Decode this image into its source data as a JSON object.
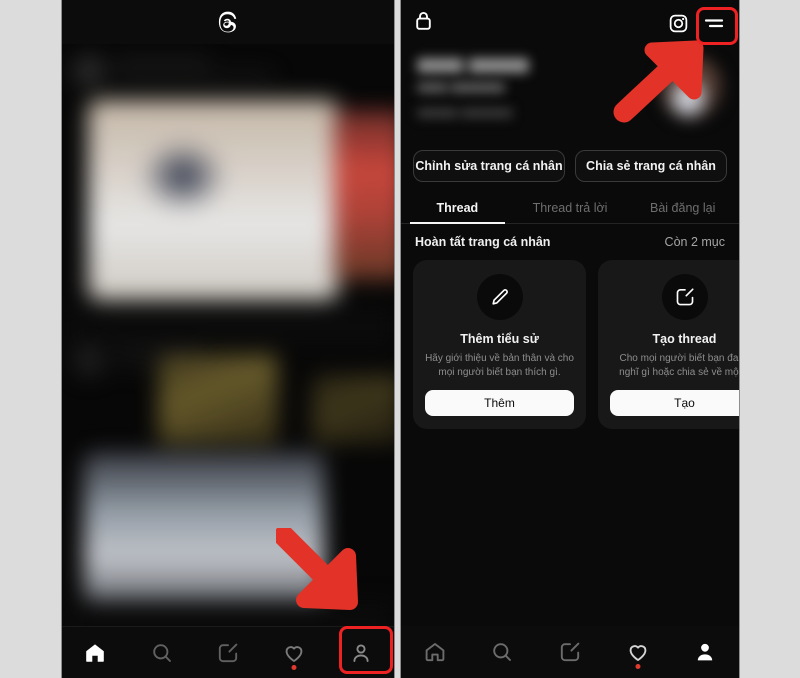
{
  "app": {
    "name": "Threads",
    "logo_icon": "threads-logo-icon"
  },
  "left_panel": {
    "topbar": {
      "logo_icon": "threads-logo-icon"
    },
    "feed_state": "blurred-feed-content",
    "bottom_nav": {
      "items": [
        {
          "icon": "home-icon",
          "label": "Trang chủ",
          "active": true,
          "badge": false
        },
        {
          "icon": "search-icon",
          "label": "Tìm kiếm",
          "active": false,
          "badge": false
        },
        {
          "icon": "compose-icon",
          "label": "Tạo",
          "active": false,
          "badge": false
        },
        {
          "icon": "heart-icon",
          "label": "Hoạt động",
          "active": false,
          "badge": true
        },
        {
          "icon": "profile-icon",
          "label": "Trang cá nhân",
          "active": false,
          "badge": false
        }
      ]
    },
    "annotation": {
      "arrow": "red-arrow-down-right",
      "highlight_target": "profile-nav-icon"
    }
  },
  "right_panel": {
    "topbar": {
      "lock_icon": "lock-icon",
      "instagram_icon": "instagram-icon",
      "menu_icon": "hamburger-menu-icon"
    },
    "profile": {
      "name_state": "blurred",
      "username_state": "blurred",
      "bio_state": "blurred",
      "avatar_state": "blurred"
    },
    "actions": [
      {
        "label": "Chỉnh sửa trang cá nhân",
        "name": "edit-profile-button"
      },
      {
        "label": "Chia sẻ trang cá nhân",
        "name": "share-profile-button"
      }
    ],
    "tabs": [
      {
        "label": "Thread",
        "active": true
      },
      {
        "label": "Thread trả lời",
        "active": false
      },
      {
        "label": "Bài đăng lại",
        "active": false
      }
    ],
    "complete_profile": {
      "title": "Hoàn tất trang cá nhân",
      "count": "Còn 2 mục"
    },
    "cards": [
      {
        "icon": "pencil-icon",
        "title": "Thêm tiểu sử",
        "desc": "Hãy giới thiệu về bản thân và cho mọi người biết bạn thích gì.",
        "button": "Thêm"
      },
      {
        "icon": "compose-icon",
        "title": "Tạo thread",
        "desc": "Cho mọi người biết bạn đang nghĩ gì hoặc chia sẻ về một h",
        "button": "Tạo"
      }
    ],
    "bottom_nav": {
      "items": [
        {
          "icon": "home-icon",
          "label": "Trang chủ",
          "active": false,
          "badge": false
        },
        {
          "icon": "search-icon",
          "label": "Tìm kiếm",
          "active": false,
          "badge": false
        },
        {
          "icon": "compose-icon",
          "label": "Tạo",
          "active": false,
          "badge": false
        },
        {
          "icon": "heart-icon",
          "label": "Hoạt động",
          "active": false,
          "badge": true
        },
        {
          "icon": "profile-icon",
          "label": "Trang cá nhân",
          "active": true,
          "badge": false
        }
      ]
    },
    "annotation": {
      "arrow": "red-arrow-up-right",
      "highlight_target": "hamburger-menu-icon"
    }
  },
  "colors": {
    "page_background": "#dcdcdc",
    "panel_background": "#0a0a0a",
    "card_background": "#181818",
    "annotation_red": "#ee2222",
    "badge_red": "#e03a2f",
    "text_primary": "#f2f2f2",
    "text_muted": "#8e8e8e"
  }
}
